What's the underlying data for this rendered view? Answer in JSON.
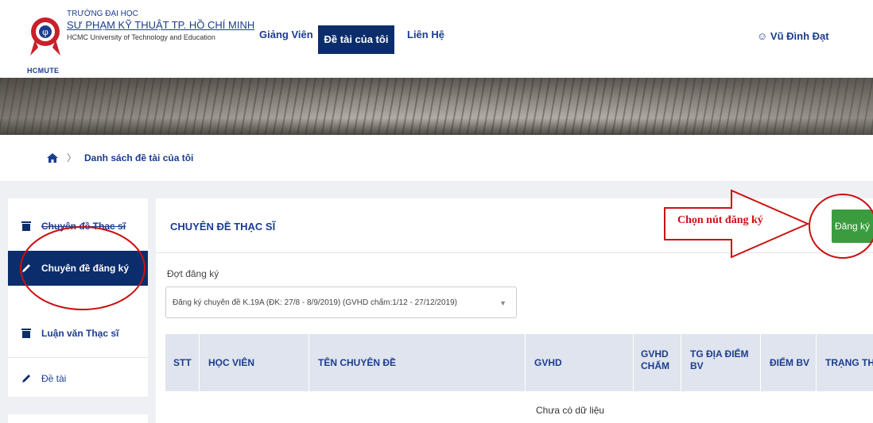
{
  "header": {
    "logo_caption": "HCMUTE",
    "university_line1": "TRƯỜNG ĐẠI HỌC",
    "university_line2": "SƯ PHẠM KỸ THUẬT TP. HỒ CHÍ MINH",
    "university_line3": "HCMC University of Technology and Education",
    "nav": [
      "Giảng Viên",
      "Đề tài của tôi",
      "Liên Hệ"
    ],
    "user": "Vũ Đình Đạt"
  },
  "breadcrumb": {
    "current": "Danh sách đề tài của tôi"
  },
  "sidebar": {
    "items": [
      {
        "label": "Chuyên đề Thạc sĩ"
      },
      {
        "label": "Chuyên đề đăng ký"
      },
      {
        "label": "Luận văn Thạc sĩ"
      },
      {
        "label": "Đề tài"
      }
    ]
  },
  "main": {
    "title": "CHUYÊN ĐỀ THẠC SĨ",
    "register_button": "Đăng ký",
    "period_label": "Đợt đăng ký",
    "period_selected": "Đăng ký chuyên đề K.19A (ĐK: 27/8 - 8/9/2019) (GVHD chấm:1/12 - 27/12/2019)",
    "table": {
      "columns": [
        "STT",
        "HỌC VIÊN",
        "TÊN CHUYÊN ĐỀ",
        "GVHD",
        "GVHD CHẤM",
        "TG ĐỊA ĐIỂM BV",
        "ĐIỂM BV",
        "TRẠNG THÁI"
      ],
      "empty_text": "Chưa có dữ liệu"
    }
  },
  "annotation": {
    "text": "Chọn nút đăng ký"
  },
  "colors": {
    "primary": "#0c2d6b",
    "accent_green": "#3a9c3e",
    "annotation_red": "#cc1010"
  }
}
